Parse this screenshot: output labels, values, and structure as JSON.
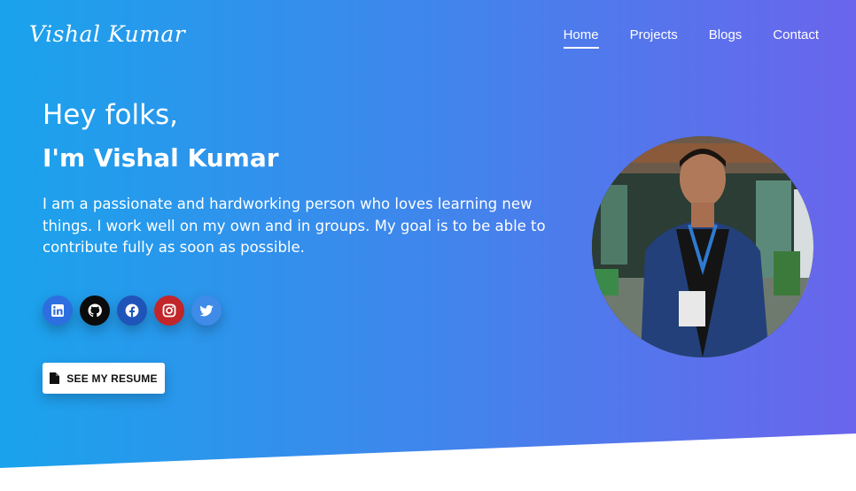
{
  "header": {
    "logo": "Vishal Kumar",
    "nav": [
      {
        "label": "Home",
        "active": true
      },
      {
        "label": "Projects",
        "active": false
      },
      {
        "label": "Blogs",
        "active": false
      },
      {
        "label": "Contact",
        "active": false
      }
    ]
  },
  "hero": {
    "greeting": "Hey folks,",
    "name": "I'm Vishal Kumar",
    "bio": "I am a passionate and hardworking person who loves learning new things. I work well on my own and in groups. My goal is to be able to contribute fully as soon as possible.",
    "socials": [
      {
        "icon": "linkedin-icon",
        "color": "#2d6fe0"
      },
      {
        "icon": "github-icon",
        "color": "#0b0b0b"
      },
      {
        "icon": "facebook-icon",
        "color": "#1f55b8"
      },
      {
        "icon": "instagram-icon",
        "color": "#c2262a"
      },
      {
        "icon": "twitter-icon",
        "color": "#3f8be8"
      }
    ],
    "resume_button": {
      "label": "SEE MY RESUME",
      "icon": "document-icon"
    },
    "profile_image": {
      "icon": "profile-photo"
    }
  },
  "colors": {
    "gradient_start": "#1aa3ec",
    "gradient_end": "#6a65ec",
    "text": "#ffffff"
  }
}
